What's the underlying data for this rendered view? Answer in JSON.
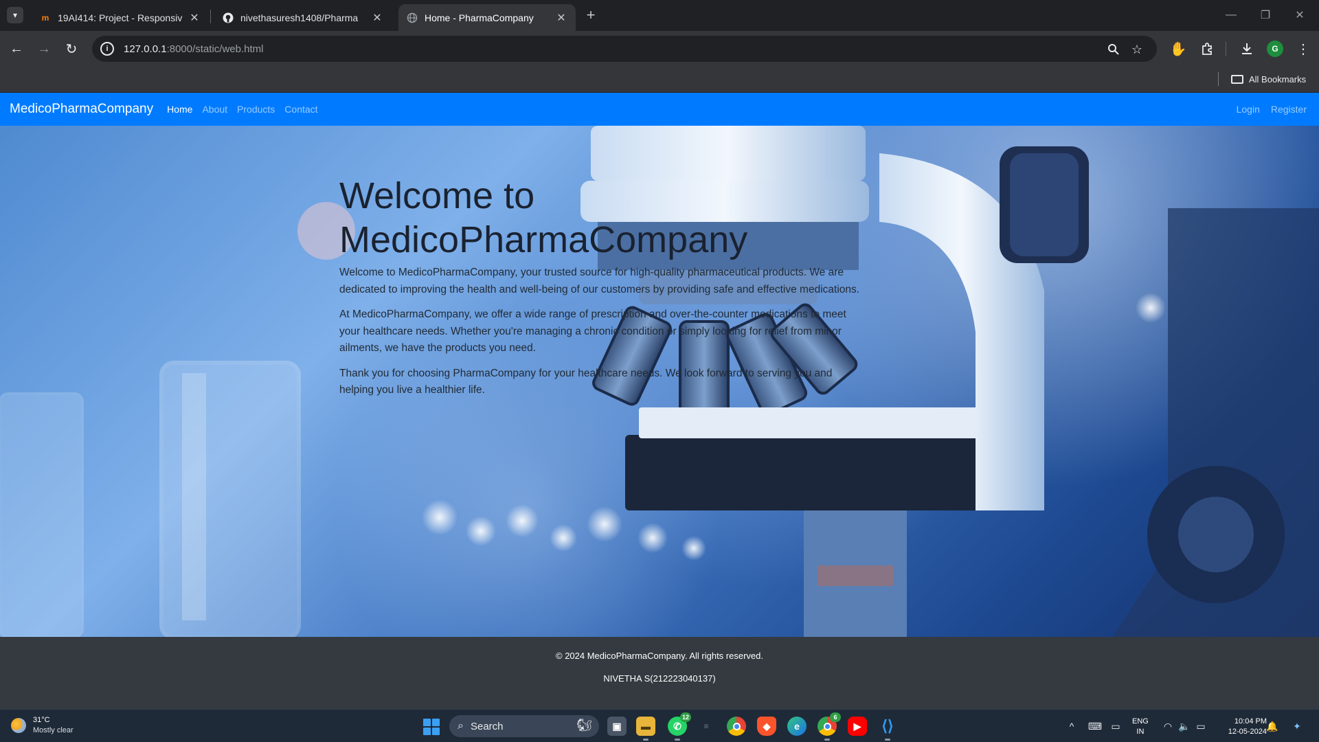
{
  "browser": {
    "tabs": [
      {
        "title": "19AI414: Project - Responsive W",
        "favicon": "moodle-icon",
        "active": false
      },
      {
        "title": "nivethasuresh1408/Pharma",
        "favicon": "github-icon",
        "active": false
      },
      {
        "title": "Home - PharmaCompany",
        "favicon": "globe-icon",
        "active": true
      }
    ],
    "url_host": "127.0.0.1",
    "url_rest": ":8000/static/web.html",
    "bookmarks_label": "All Bookmarks",
    "profile_initial": "G"
  },
  "site": {
    "brand": "MedicoPharmaCompany",
    "nav": [
      "Home",
      "About",
      "Products",
      "Contact"
    ],
    "nav_right": [
      "Login",
      "Register"
    ],
    "hero": {
      "title": "Welcome to MedicoPharmaCompany",
      "paragraphs": [
        "Welcome to MedicoPharmaCompany, your trusted source for high-quality pharmaceutical products. We are dedicated to improving the health and well-being of our customers by providing safe and effective medications.",
        "At MedicoPharmaCompany, we offer a wide range of prescription and over-the-counter medications to meet your healthcare needs. Whether you're managing a chronic condition or simply looking for relief from minor ailments, we have the products you need.",
        "Thank you for choosing PharmaCompany for your healthcare needs. We look forward to serving you and helping you live a healthier life."
      ]
    },
    "footer": {
      "copyright": "© 2024 MedicoPharmaCompany. All rights reserved.",
      "credit": "NIVETHA S(212223040137)"
    }
  },
  "taskbar": {
    "weather_temp": "31°C",
    "weather_cond": "Mostly clear",
    "search_label": "Search",
    "whatsapp_badge": "12",
    "chrome2_badge": "6",
    "lang_line1": "ENG",
    "lang_line2": "IN",
    "time": "10:04 PM",
    "date": "12-05-2024"
  }
}
